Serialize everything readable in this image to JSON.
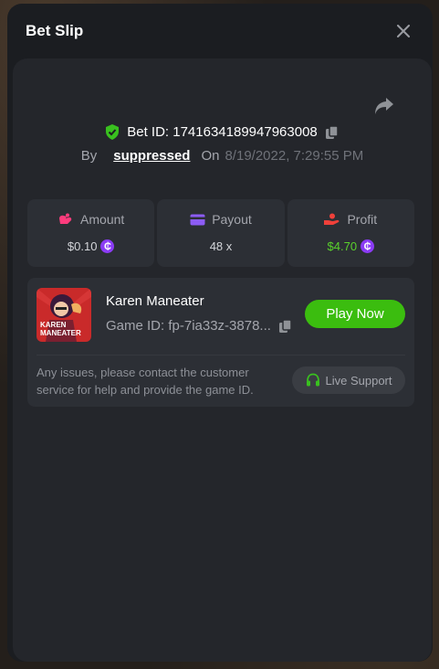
{
  "modal": {
    "title": "Bet Slip"
  },
  "bet": {
    "id_label": "Bet ID: 1741634189947963008",
    "by_label": "By",
    "user": "suppressed",
    "on_label": "On",
    "date": "8/19/2022, 7:29:55 PM"
  },
  "stats": {
    "amount": {
      "label": "Amount",
      "value": "$0.10",
      "icon": "amount-icon"
    },
    "payout": {
      "label": "Payout",
      "value": "48 x",
      "icon": "card-icon"
    },
    "profit": {
      "label": "Profit",
      "value": "$4.70",
      "icon": "profit-hand-icon"
    }
  },
  "coin_symbol": "₵",
  "game": {
    "name": "Karen Maneater",
    "id_label": "Game ID: fp-7ia33z-3878...",
    "thumb_text_line1": "KAREN",
    "thumb_text_line2": "MANEATER",
    "play_label": "Play Now"
  },
  "support": {
    "message": "Any issues, please contact the customer service for help and provide the game ID.",
    "button_label": "Live Support"
  },
  "colors": {
    "accent_green": "#3bbd0f",
    "profit_green": "#5ad22c",
    "coin_purple": "#8b3bf5",
    "amount_pink": "#ff3c7d",
    "payout_purple": "#8c5cf5",
    "profit_red": "#f0403a"
  }
}
